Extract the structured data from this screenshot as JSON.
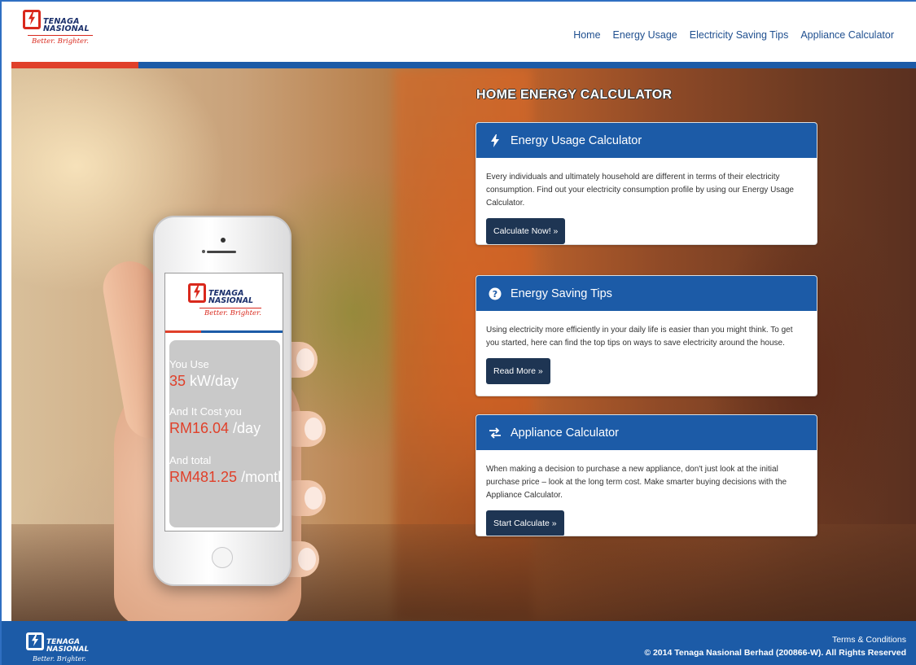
{
  "brand": {
    "name_line1": "TENAGA",
    "name_line2": "NASIONAL",
    "tagline": "Better. Brighter.",
    "primary_color": "#1c5ba7",
    "accent_color": "#e0402a",
    "button_color": "#1e3553"
  },
  "nav": {
    "items": [
      {
        "label": "Home"
      },
      {
        "label": "Energy Usage"
      },
      {
        "label": "Electricity Saving Tips"
      },
      {
        "label": "Appliance Calculator"
      }
    ]
  },
  "hero": {
    "title": "HOME ENERGY CALCULATOR"
  },
  "phone": {
    "use_label": "You Use",
    "use_value": "35",
    "use_unit": " kW/day",
    "cost_label": "And It Cost you",
    "cost_value": "RM16.04",
    "cost_unit": " /day",
    "total_label": "And total",
    "total_value": "RM481.25",
    "total_unit": " /month"
  },
  "cards": [
    {
      "icon": "bolt-icon",
      "title": "Energy Usage Calculator",
      "text": "Every individuals and ultimately household are different in terms of their electricity consumption. Find out your electricity consumption profile by using our Energy Usage Calculator.",
      "button": "Calculate Now! »"
    },
    {
      "icon": "question-circle-icon",
      "title": "Energy Saving Tips",
      "text": "Using electricity more efficiently in your daily life is easier than you might think. To get you started, here can find the top tips on ways to save electricity around the house.",
      "button": "Read More »"
    },
    {
      "icon": "exchange-icon",
      "title": "Appliance Calculator",
      "text": "When making a decision to purchase a new appliance, don't just look at the initial purchase price – look at the long term cost. Make smarter buying decisions with the Appliance Calculator.",
      "button": "Start Calculate »"
    }
  ],
  "footer": {
    "terms": "Terms & Conditions",
    "copyright": "© 2014 Tenaga Nasional Berhad (200866-W). All Rights Reserved"
  }
}
